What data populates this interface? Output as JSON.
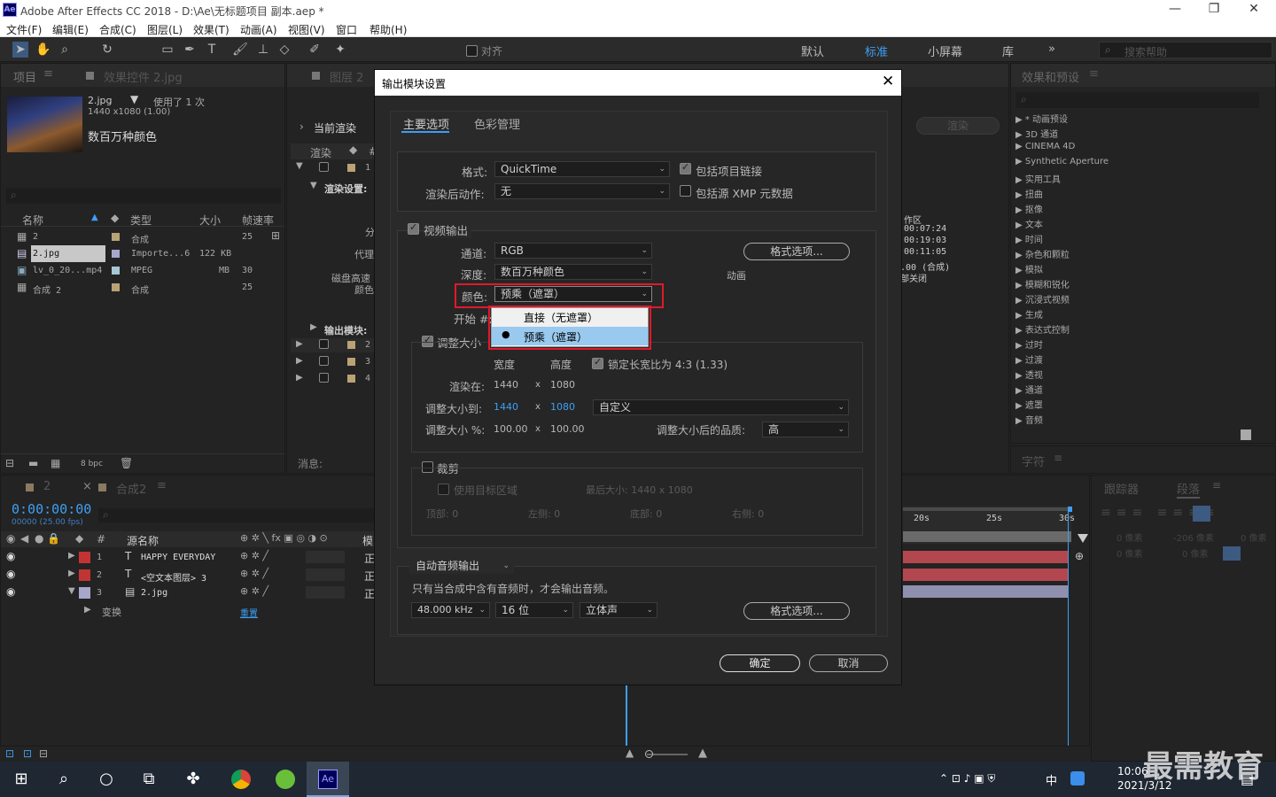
{
  "window": {
    "title": "Adobe After Effects CC 2018 - D:\\Ae\\无标题项目 副本.aep *",
    "logo": "Ae"
  },
  "menu": [
    "文件(F)",
    "编辑(E)",
    "合成(C)",
    "图层(L)",
    "效果(T)",
    "动画(A)",
    "视图(V)",
    "窗口",
    "帮助(H)"
  ],
  "toolbar": {
    "align_label": "对齐",
    "workspaces": [
      "默认",
      "标准",
      "小屏幕",
      "库"
    ],
    "search_placeholder": "搜索帮助"
  },
  "project": {
    "tab": "项目",
    "effects_tab": "效果控件 2.jpg",
    "file_name": "2.jpg",
    "usage": "使用了 1 次",
    "dims": "1440 x1080 (1.00)",
    "color_info": "数百万种颜色",
    "columns": {
      "name": "名称",
      "type": "类型",
      "size": "大小",
      "fps": "帧速率"
    },
    "rows": [
      {
        "name": "2",
        "type": "合成",
        "size": "",
        "fps": "25",
        "color": "#b9a276"
      },
      {
        "name": "2.jpg",
        "type": "Importe...6",
        "size": "122 KB",
        "fps": "",
        "color": "#a7a7cc"
      },
      {
        "name": "lv_0_20...mp4",
        "type": "MPEG",
        "size": "MB",
        "fps": "30",
        "color": "#a6c7d3"
      },
      {
        "name": "合成 2",
        "type": "合成",
        "size": "",
        "fps": "25",
        "color": "#b9a276"
      }
    ],
    "bpc": "8 bpc"
  },
  "render_queue": {
    "tab_label": "图层 2",
    "current": "当前渲染",
    "col1": "渲染",
    "settings": "渲染设置:",
    "output": "输出模块:",
    "partial_labels": [
      "分",
      "代理",
      "磁盘高速",
      "颜色"
    ],
    "msg": "消息:",
    "rows": [
      "1",
      "2",
      "3",
      "4"
    ],
    "render_btn": "渲染",
    "right_info": [
      "作区",
      "00:07:24",
      "00:19:03",
      "00:11:05",
      ".00 (合成)",
      "部关闭"
    ],
    "anim_label": "动画"
  },
  "effects": {
    "tab": "效果和预设",
    "items": [
      "* 动画预设",
      "3D 通道",
      "CINEMA 4D",
      "Synthetic Aperture",
      "实用工具",
      "扭曲",
      "抠像",
      "文本",
      "时间",
      "杂色和颗粒",
      "模拟",
      "模糊和锐化",
      "沉浸式视频",
      "生成",
      "表达式控制",
      "过时",
      "过渡",
      "透视",
      "通道",
      "遮罩",
      "音频"
    ],
    "char_tab": "字符"
  },
  "timeline": {
    "tabs": [
      "2",
      "合成2"
    ],
    "timecode": "0:00:00:00",
    "frames": "00000 (25.00 fps)",
    "col_source": "源名称",
    "col_mode": "模",
    "layers": [
      {
        "num": "1",
        "kind": "T",
        "name": "HAPPY EVERYDAY",
        "mode": "正",
        "color": "#c23434"
      },
      {
        "num": "2",
        "kind": "T",
        "name": "<空文本图层> 3",
        "mode": "正",
        "color": "#c23434"
      },
      {
        "num": "3",
        "kind": "img",
        "name": "2.jpg",
        "mode": "正",
        "color": "#a7a7cc"
      }
    ],
    "transform": "变换",
    "reset": "重置",
    "ruler": [
      "20s",
      "25s",
      "30s"
    ]
  },
  "tracker": {
    "tab": "跟踪器",
    "para_tab": "段落",
    "px": [
      "0 像素",
      "-206 像素",
      "0 像素",
      "0 像素",
      "0 像素"
    ]
  },
  "dialog": {
    "title": "输出模块设置",
    "tabs": [
      "主要选项",
      "色彩管理"
    ],
    "format_label": "格式:",
    "format_value": "QuickTime",
    "post_label": "渲染后动作:",
    "post_value": "无",
    "include_link": "包括项目链接",
    "include_xmp": "包括源 XMP 元数据",
    "video_output": "视频输出",
    "channel_label": "通道:",
    "channel_value": "RGB",
    "depth_label": "深度:",
    "depth_value": "数百万种颜色",
    "color_label": "颜色:",
    "color_value": "预乘（遮罩）",
    "start_label": "开始 #:",
    "format_options": "格式选项...",
    "color_options": [
      "直接（无遮罩）",
      "预乘（遮罩）"
    ],
    "resize": "调整大小",
    "width_hdr": "宽度",
    "height_hdr": "高度",
    "lock_ratio": "锁定长宽比为 4:3 (1.33)",
    "render_at": "渲染在:",
    "render_w": "1440",
    "render_h": "1080",
    "resize_to": "调整大小到:",
    "resize_w": "1440",
    "resize_h": "1080",
    "resize_preset": "自定义",
    "resize_pct": "调整大小 %:",
    "pct_w": "100.00",
    "pct_h": "100.00",
    "quality_label": "调整大小后的品质:",
    "quality_value": "高",
    "x": "x",
    "crop": "裁剪",
    "use_roi": "使用目标区域",
    "max_size": "最后大小: 1440 x 1080",
    "top": "顶部: 0",
    "left": "左侧: 0",
    "bottom": "底部: 0",
    "right": "右侧: 0",
    "audio_mode": "自动音频输出",
    "audio_note": "只有当合成中含有音频时，才会输出音频。",
    "rate": "48.000 kHz",
    "bits": "16 位",
    "channels": "立体声",
    "ok": "确定",
    "cancel": "取消"
  },
  "taskbar": {
    "time": "10:06",
    "date": "2021/3/12",
    "ime": "中",
    "watermark": "最需教育"
  }
}
